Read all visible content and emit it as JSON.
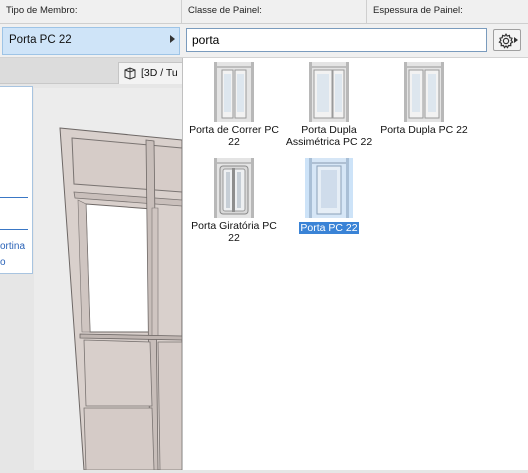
{
  "header": {
    "member_type_label": "Tipo de Membro:",
    "panel_class_label": "Classe de Painel:",
    "panel_thickness_label": "Espessura de Painel:"
  },
  "member_select": {
    "value": "Porta PC 22"
  },
  "search": {
    "value": "porta"
  },
  "view_tab": {
    "label": "[3D / Tu"
  },
  "side_panel": {
    "text_1": "ortina",
    "text_2": "o"
  },
  "results": [
    {
      "name": "Porta de Correr PC 22",
      "selected": false
    },
    {
      "name": "Porta Dupla Assimétrica PC 22",
      "selected": false
    },
    {
      "name": "Porta Dupla PC 22",
      "selected": false
    },
    {
      "name": "Porta Giratória PC 22",
      "selected": false
    },
    {
      "name": "Porta PC 22",
      "selected": true
    }
  ],
  "colors": {
    "selection": "#3a83d6",
    "selection_bg": "#cde3f8",
    "wall": "#d8d0cc"
  }
}
